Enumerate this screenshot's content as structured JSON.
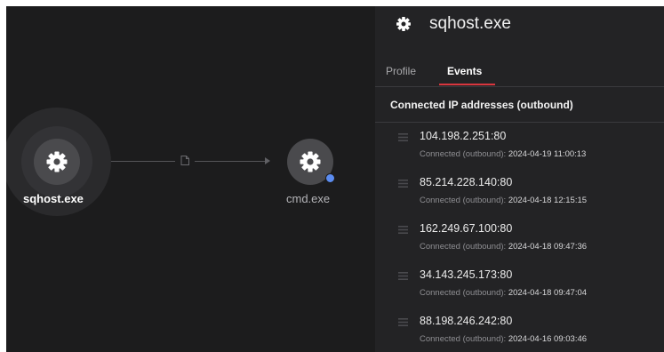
{
  "graph": {
    "nodes": [
      {
        "label": "sqhost.exe",
        "icon": "gear-icon",
        "label_color": "#ffffff",
        "selected": true
      },
      {
        "label": "cmd.exe",
        "icon": "gear-icon",
        "label_color": "#b4b4b8",
        "status_color": "#5b8cf0"
      }
    ],
    "edge_icon": "document-icon"
  },
  "panel": {
    "title": "sqhost.exe",
    "title_icon": "gear-icon",
    "tabs": [
      {
        "label": "Profile",
        "active": false
      },
      {
        "label": "Events",
        "active": true
      }
    ],
    "accent_color": "#d9363e",
    "section_title": "Connected IP addresses (outbound)",
    "connections": [
      {
        "ip": "104.198.2.251:80",
        "label": "Connected (outbound):",
        "time": "2024-04-19 11:00:13"
      },
      {
        "ip": "85.214.228.140:80",
        "label": "Connected (outbound):",
        "time": "2024-04-18 12:15:15"
      },
      {
        "ip": "162.249.67.100:80",
        "label": "Connected (outbound):",
        "time": "2024-04-18 09:47:36"
      },
      {
        "ip": "34.143.245.173:80",
        "label": "Connected (outbound):",
        "time": "2024-04-18 09:47:04"
      },
      {
        "ip": "88.198.246.242:80",
        "label": "Connected (outbound):",
        "time": "2024-04-16 09:03:46"
      }
    ]
  }
}
